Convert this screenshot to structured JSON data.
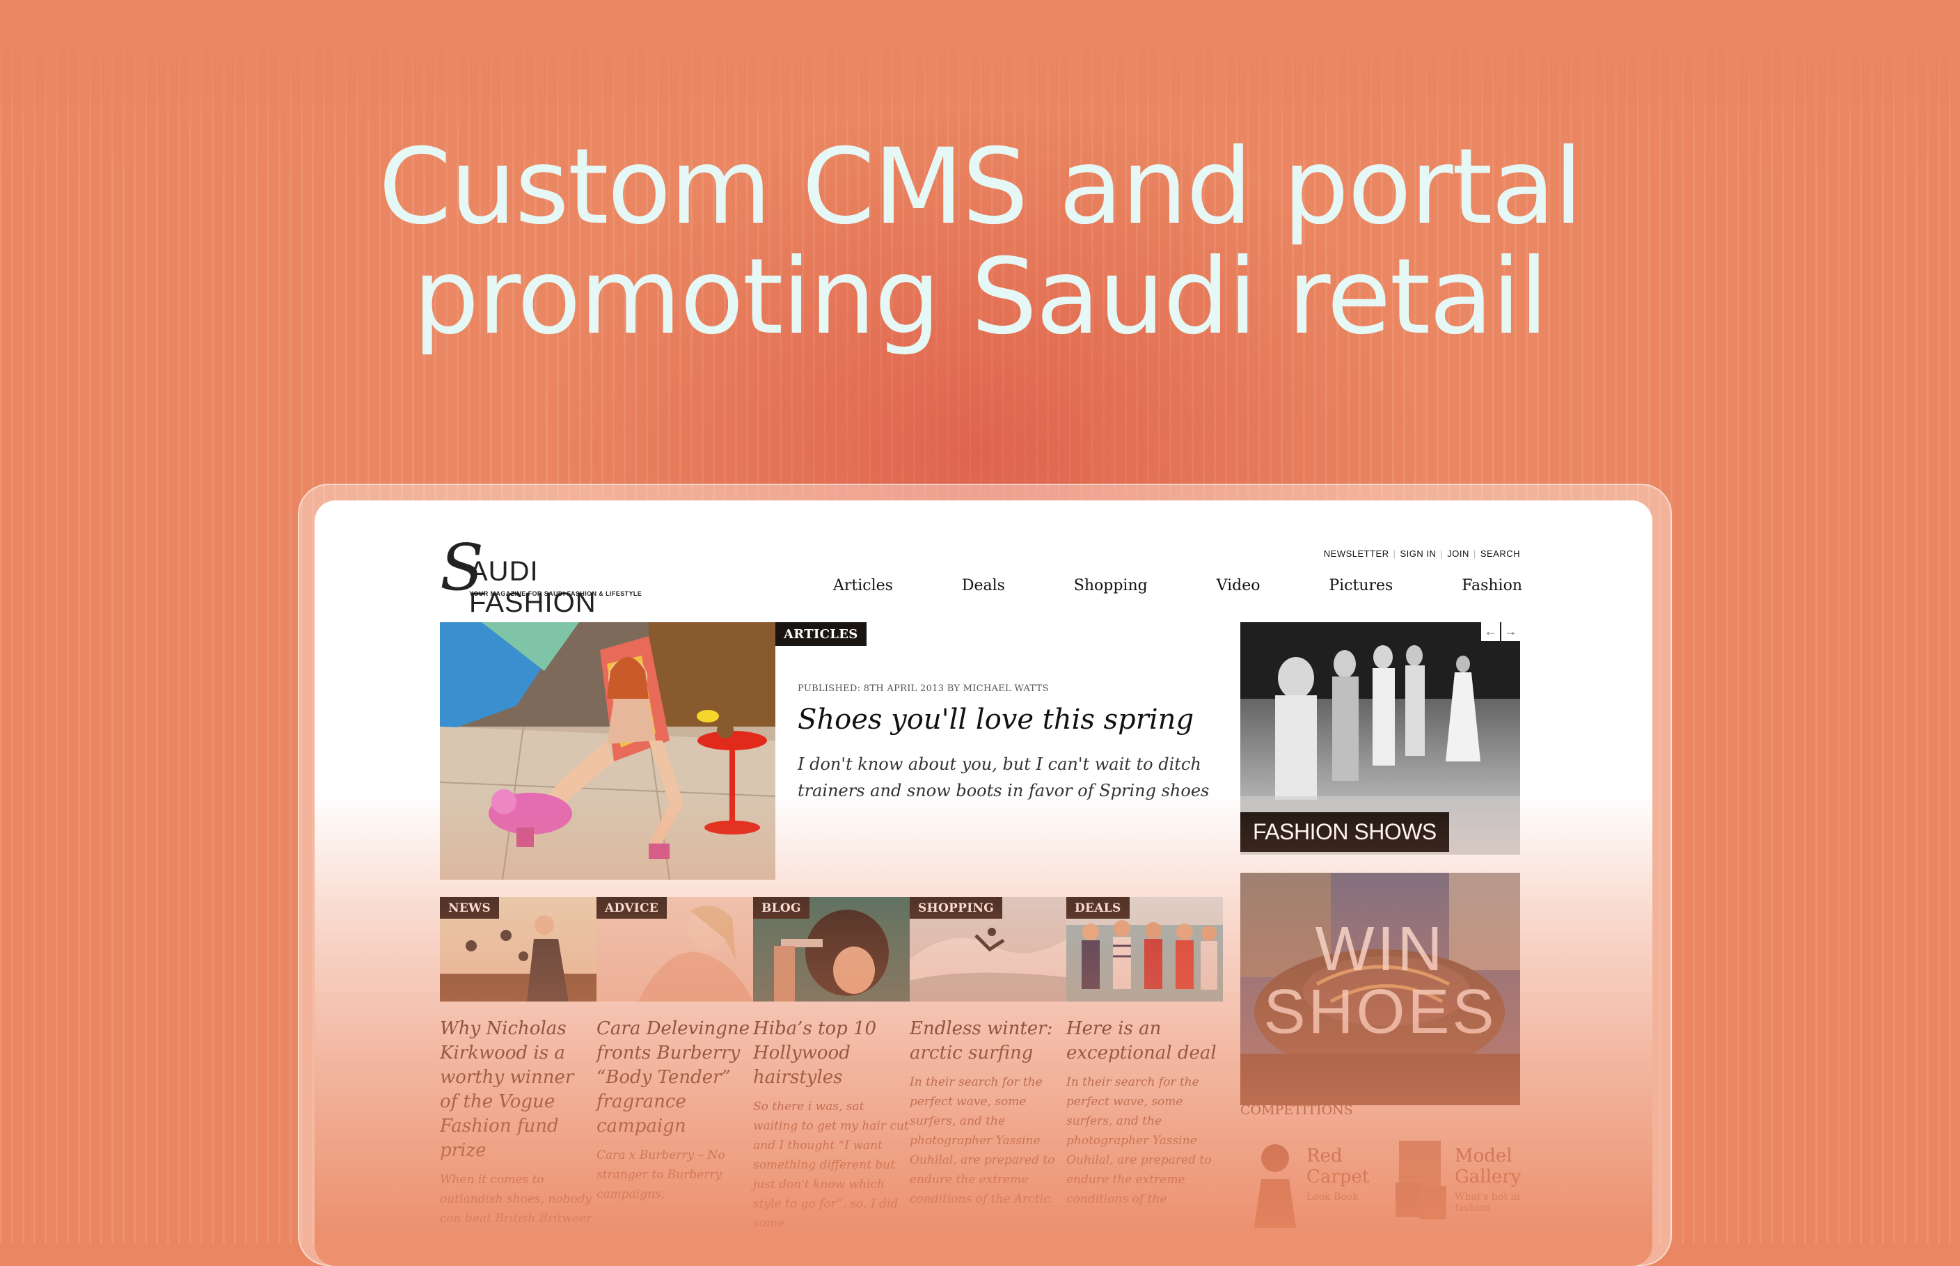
{
  "headline": {
    "line1": "Custom CMS and portal",
    "line2": "promoting Saudi retail"
  },
  "site": {
    "logo_mark": "S",
    "logo_text": "AUDI FASHION",
    "tagline": "YOUR MAGAZINE FOR SAUDI FASHION & LIFESTYLE",
    "toplinks": [
      "NEWSLETTER",
      "SIGN IN",
      "JOIN",
      "SEARCH"
    ],
    "nav": [
      "Articles",
      "Deals",
      "Shopping",
      "Video",
      "Pictures",
      "Fashion"
    ]
  },
  "hero": {
    "tag": "ARTICLES",
    "published": "PUBLISHED: 8TH APRIL 2013 BY MICHAEL WATTS",
    "title": "Shoes you'll love this spring",
    "summary": "I don't know about you, but I can't wait to ditch trainers and snow boots in favor of Spring shoes"
  },
  "sidebar": {
    "arrow_prev": "←",
    "arrow_next": "→",
    "fashion_shows_label": "FASHION SHOWS",
    "win_line1": "WIN",
    "win_line2": "SHOES",
    "competitions_label": "COMPETITIONS",
    "minis": [
      {
        "title_1": "Red",
        "title_2": "Carpet",
        "sub": "Look Book"
      },
      {
        "title_1": "Model",
        "title_2": "Gallery",
        "sub": "What's hot in fashion"
      }
    ]
  },
  "cards": [
    {
      "tag": "NEWS",
      "title": "Why Nicholas Kirkwood is a worthy winner of the Vogue Fashion fund prize",
      "summary": "When it comes to outlandish shoes, nobody can beat British Britweer"
    },
    {
      "tag": "ADVICE",
      "title": "Cara Delevingne fronts Burberry “Body Tender” fragrance campaign",
      "summary": "Cara x Burberry – No stranger to Burberry campaigns,"
    },
    {
      "tag": "BLOG",
      "title": "Hiba’s top 10 Hollywood hairstyles",
      "summary": "So there i was, sat waiting to get my hair cut and I thought “I want something different but just don't know which style to go for”, so, I did some"
    },
    {
      "tag": "SHOPPING",
      "title": "Endless winter: arctic surfing",
      "summary": "In their search for the perfect wave, some surfers, and the photographer Yassine Ouhilal, are prepared to endure the extreme conditions of the Arctic."
    },
    {
      "tag": "DEALS",
      "title": "Here is an exceptional deal",
      "summary": "In their search for the perfect wave, some surfers, and the photographer Yassine Ouhilal, are prepared to endure the extreme conditions of the"
    }
  ],
  "colors": {
    "background": "#ea8661",
    "headline": "#e6f8f5",
    "tag_bg": "#1b1512"
  }
}
